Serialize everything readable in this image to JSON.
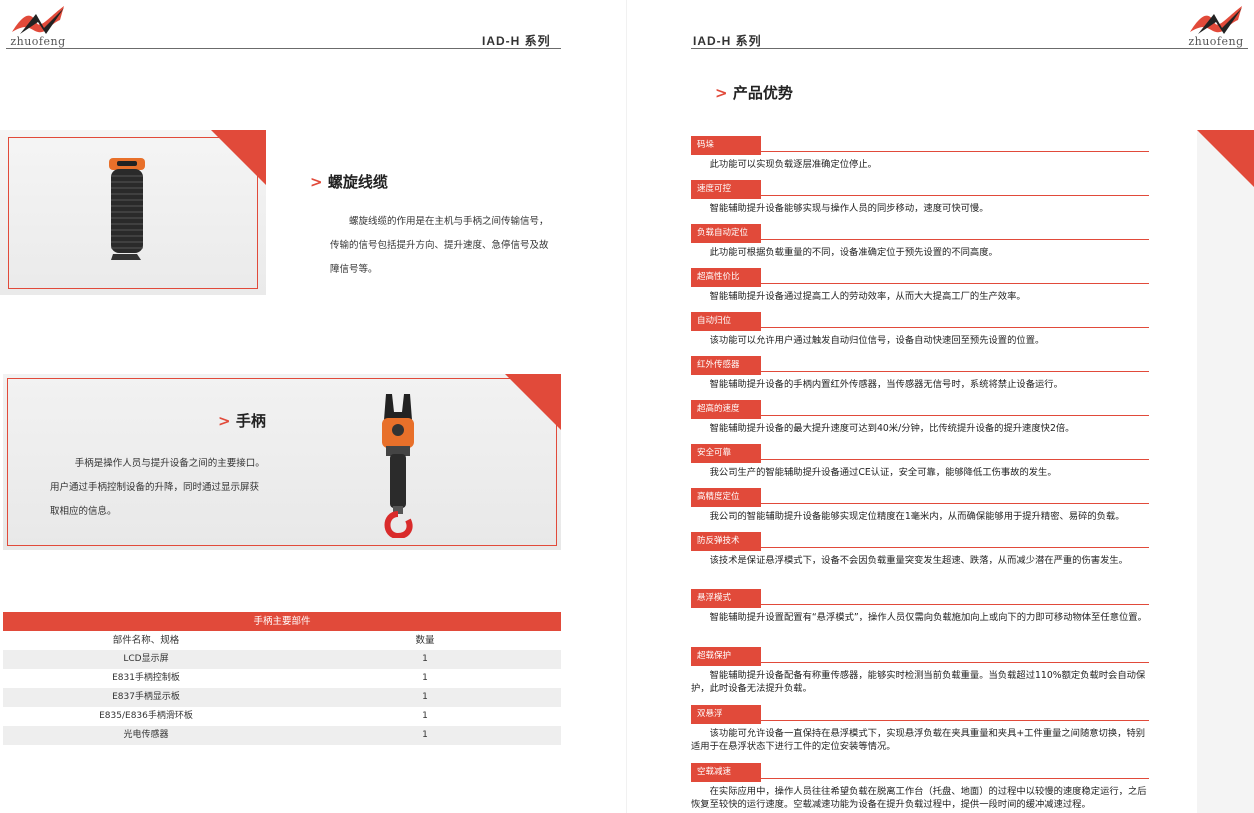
{
  "header": {
    "logo_text": "zhuofeng",
    "series": "IAD-H 系列"
  },
  "cable": {
    "title": "螺旋线缆",
    "desc_line1": "螺旋线缆的作用是在主机与手柄之间传输信号，",
    "desc_line2": "传输的信号包括提升方向、提升速度、急停信号及故",
    "desc_line3": "障信号等。"
  },
  "handle": {
    "title": "手柄",
    "desc_line1": "手柄是操作人员与提升设备之间的主要接口。",
    "desc_line2": "用户通过手柄控制设备的升降，同时通过显示屏获",
    "desc_line3": "取相应的信息。"
  },
  "parts_table": {
    "title": "手柄主要部件",
    "col_name": "部件名称、规格",
    "col_qty": "数量",
    "rows": [
      {
        "name": "LCD显示屏",
        "qty": "1"
      },
      {
        "name": "E831手柄控制板",
        "qty": "1"
      },
      {
        "name": "E837手柄显示板",
        "qty": "1"
      },
      {
        "name": "E835/E836手柄滑环板",
        "qty": "1"
      },
      {
        "name": "光电传感器",
        "qty": "1"
      }
    ]
  },
  "advantages": {
    "title": "产品优势",
    "items": [
      {
        "label": "码垛",
        "desc": "此功能可以实现负载逐层准确定位停止。"
      },
      {
        "label": "速度可控",
        "desc": "智能辅助提升设备能够实现与操作人员的同步移动，速度可快可慢。"
      },
      {
        "label": "负载自动定位",
        "desc": "此功能可根据负载重量的不同，设备准确定位于预先设置的不同高度。"
      },
      {
        "label": "超高性价比",
        "desc": "智能辅助提升设备通过提高工人的劳动效率，从而大大提高工厂的生产效率。"
      },
      {
        "label": "自动归位",
        "desc": "该功能可以允许用户通过触发自动归位信号，设备自动快速回至预先设置的位置。"
      },
      {
        "label": "红外传感器",
        "desc": "智能辅助提升设备的手柄内置红外传感器，当传感器无信号时，系统将禁止设备运行。"
      },
      {
        "label": "超高的速度",
        "desc": "智能辅助提升设备的最大提升速度可达到40米/分钟，比传统提升设备的提升速度快2倍。"
      },
      {
        "label": "安全可靠",
        "desc": "我公司生产的智能辅助提升设备通过CE认证，安全可靠，能够降低工伤事故的发生。"
      },
      {
        "label": "高精度定位",
        "desc": "我公司的智能辅助提升设备能够实现定位精度在1毫米内，从而确保能够用于提升精密、易碎的负载。"
      },
      {
        "label": "防反弹技术",
        "desc": "该技术是保证悬浮模式下，设备不会因负载重量突变发生超速、跌落，从而减少潜在严重的伤害发生。"
      },
      {
        "label": "悬浮模式",
        "desc": "智能辅助提升设置配置有“悬浮模式”，操作人员仅需向负载施加向上或向下的力即可移动物体至任意位置。"
      },
      {
        "label": "超载保护",
        "desc": "智能辅助提升设备配备有称重传感器，能够实时检测当前负载重量。当负载超过110%额定负载时会自动保护，此时设备无法提升负载。"
      },
      {
        "label": "双悬浮",
        "desc": "该功能可允许设备一直保持在悬浮模式下，实现悬浮负载在夹具重量和夹具+工件重量之间随意切换，特别适用于在悬浮状态下进行工件的定位安装等情况。"
      },
      {
        "label": "空载减速",
        "desc": "在实际应用中，操作人员往往希望负载在脱离工作台（托盘、地面）的过程中以较慢的速度稳定运行，之后恢复至较快的运行速度。空载减速功能为设备在提升负载过程中，提供一段时间的缓冲减速过程。"
      }
    ]
  },
  "colors": {
    "accent": "#e14a3a"
  }
}
